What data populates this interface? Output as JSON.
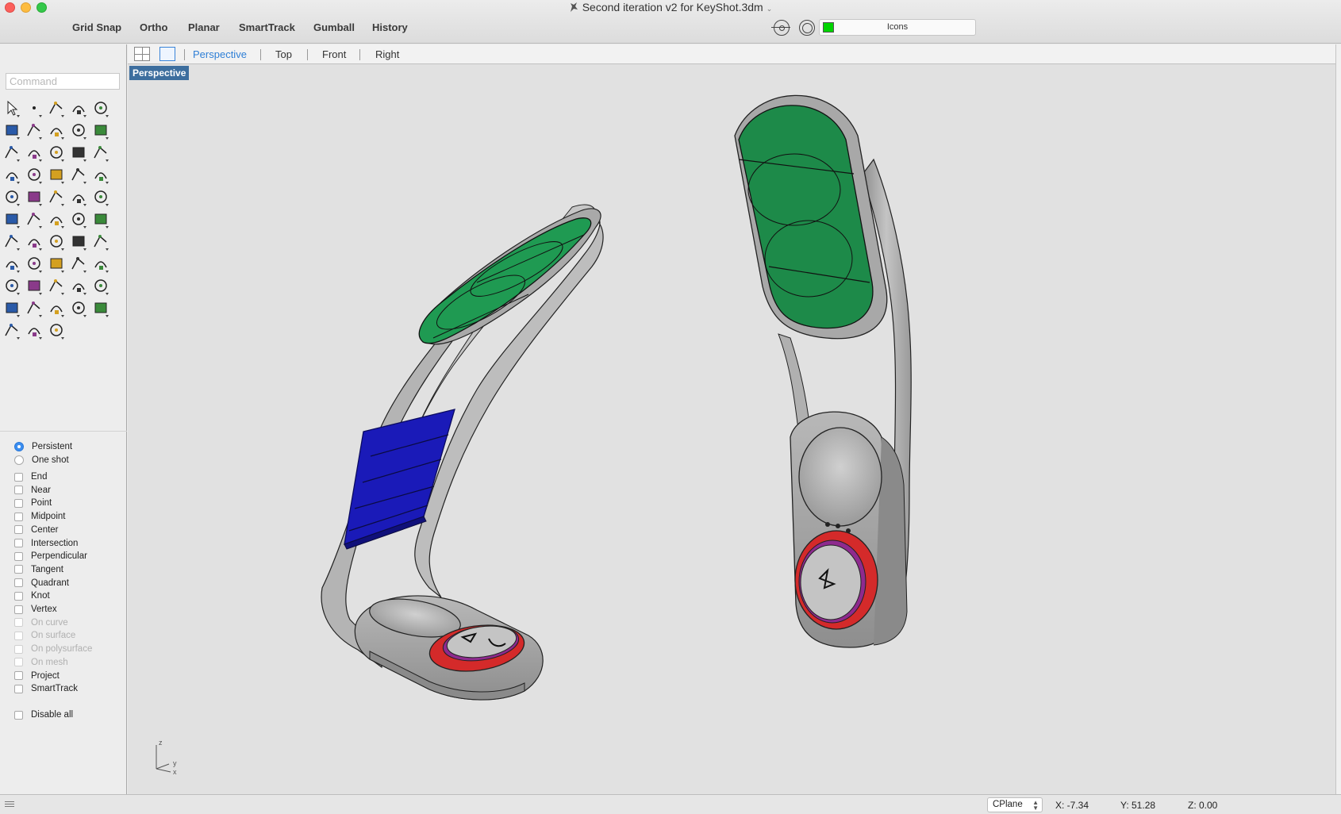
{
  "window": {
    "title": "Second iteration v2 for KeyShot.3dm"
  },
  "toolbar": {
    "buttons": [
      "Grid Snap",
      "Ortho",
      "Planar",
      "SmartTrack",
      "Gumball",
      "History"
    ],
    "layer": {
      "name": "Icons",
      "color": "#00d400"
    }
  },
  "command": {
    "placeholder": "Command"
  },
  "viewport_tabs": [
    "Perspective",
    "Top",
    "Front",
    "Right"
  ],
  "active_viewport": "Perspective",
  "osnap": {
    "modes": [
      {
        "label": "Persistent",
        "selected": true
      },
      {
        "label": "One shot",
        "selected": false
      }
    ],
    "snaps": [
      {
        "label": "End",
        "enabled": true
      },
      {
        "label": "Near",
        "enabled": true
      },
      {
        "label": "Point",
        "enabled": true
      },
      {
        "label": "Midpoint",
        "enabled": true
      },
      {
        "label": "Center",
        "enabled": true
      },
      {
        "label": "Intersection",
        "enabled": true
      },
      {
        "label": "Perpendicular",
        "enabled": true
      },
      {
        "label": "Tangent",
        "enabled": true
      },
      {
        "label": "Quadrant",
        "enabled": true
      },
      {
        "label": "Knot",
        "enabled": true
      },
      {
        "label": "Vertex",
        "enabled": true
      },
      {
        "label": "On curve",
        "enabled": false
      },
      {
        "label": "On surface",
        "enabled": false
      },
      {
        "label": "On polysurface",
        "enabled": false
      },
      {
        "label": "On mesh",
        "enabled": false
      },
      {
        "label": "Project",
        "enabled": true
      },
      {
        "label": "SmartTrack",
        "enabled": true
      }
    ],
    "disable_all": "Disable all"
  },
  "axis_labels": {
    "z": "z",
    "y": "y",
    "x": "x"
  },
  "status": {
    "cplane": "CPlane",
    "x": "X: -7.34",
    "y": "Y: 51.28",
    "z": "Z: 0.00"
  },
  "model_colors": {
    "frame": "#a8a8a8",
    "green_panel": "#1f9a52",
    "green_panel_2": "#1d8a49",
    "blue_panel": "#1a1ab8",
    "red_ring": "#d42a2a"
  },
  "tool_icons": [
    "select-arrow",
    "point",
    "polyline",
    "curve",
    "circle",
    "ellipse",
    "arc",
    "rectangle",
    "polygon",
    "fillet",
    "surface",
    "extrude-surface",
    "box",
    "solid-sphere",
    "cylinder",
    "mesh",
    "gear-transform",
    "flow",
    "split",
    "trim",
    "boolean",
    "group",
    "blend",
    "offset",
    "text",
    "move",
    "array",
    "scale",
    "block",
    "dimension",
    "grid-array",
    "align",
    "edit",
    "check",
    "analyze",
    "paint",
    "zoom",
    "zoom-window",
    "zoom-extents",
    "magnify",
    "rotate-view",
    "car",
    "plane",
    "light-grid",
    "bulb",
    "lock",
    "layer",
    "color-wheel",
    "shade",
    "wire-sphere",
    "render-sphere",
    "cone",
    "transform-node"
  ]
}
